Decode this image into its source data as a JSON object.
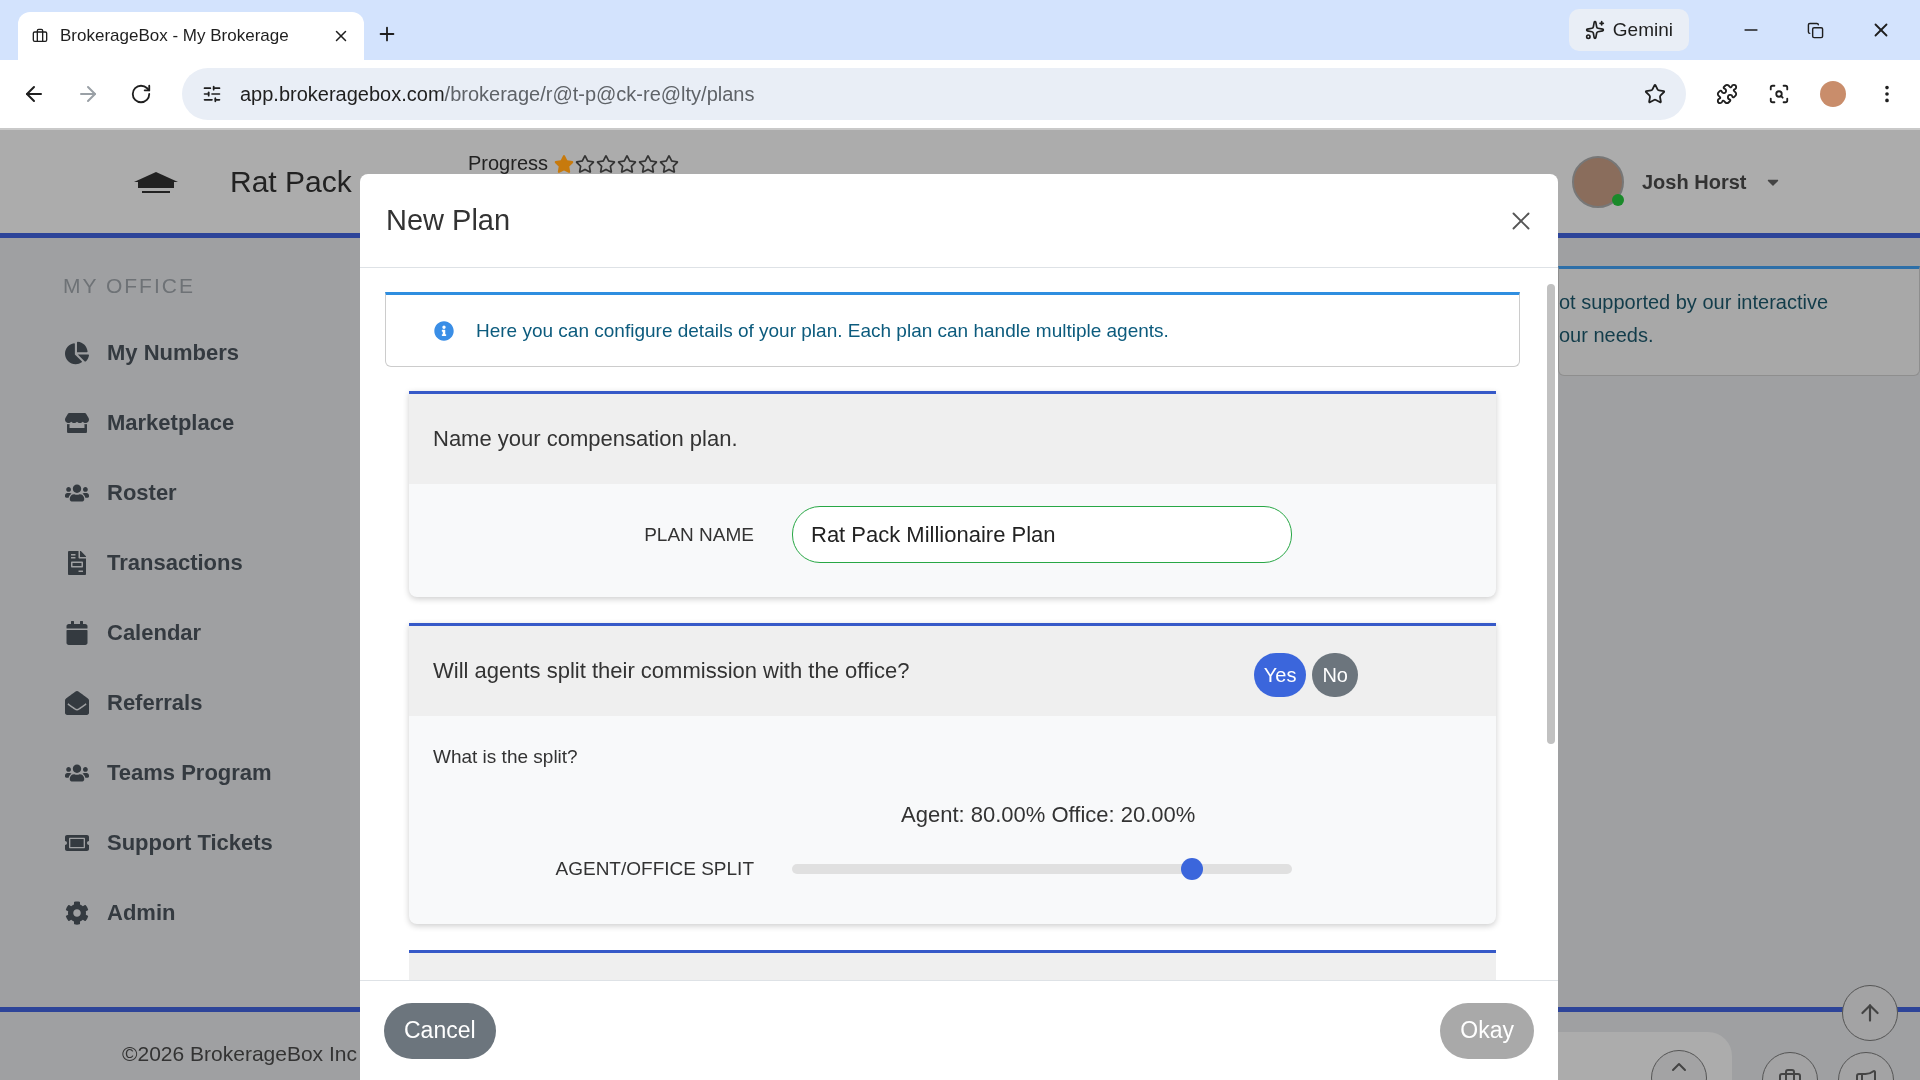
{
  "browser": {
    "tab_title": "BrokerageBox - My Brokerage",
    "gemini": "Gemini",
    "url_host": "app.brokeragebox.com",
    "url_path": "/brokerage/r@t-p@ck-re@lty/plans"
  },
  "header": {
    "brand": "Rat Pack",
    "progress_label": "Progress",
    "stars": 1,
    "user": "Josh Horst"
  },
  "sidebar": {
    "heading": "MY OFFICE",
    "items": [
      {
        "label": "My Numbers"
      },
      {
        "label": "Marketplace"
      },
      {
        "label": "Roster"
      },
      {
        "label": "Transactions"
      },
      {
        "label": "Calendar"
      },
      {
        "label": "Referrals"
      },
      {
        "label": "Teams Program"
      },
      {
        "label": "Support Tickets"
      },
      {
        "label": "Admin"
      }
    ]
  },
  "notice": {
    "lines": [
      "ot supported by our interactive",
      "our needs."
    ]
  },
  "footer": {
    "copyright": "©2026 BrokerageBox Inc"
  },
  "modal": {
    "title": "New Plan",
    "info": "Here you can configure details of your plan. Each plan can handle multiple agents.",
    "sections": [
      {
        "kind": "name",
        "question": "Name your compensation plan.",
        "field_label": "PLAN NAME",
        "value": "Rat Pack Millionaire Plan"
      },
      {
        "kind": "split",
        "question": "Will agents split their commission with the office?",
        "options": [
          {
            "label": "Yes",
            "selected": true
          },
          {
            "label": "No",
            "selected": false
          }
        ],
        "sub_question": "What is the split?",
        "reading": "Agent: 80.00% Office: 20.00%",
        "slider_label": "AGENT/OFFICE SPLIT",
        "level": 0.8
      }
    ],
    "buttons": [
      {
        "label": "Cancel",
        "disabled": false
      },
      {
        "label": "Okay",
        "disabled": true
      }
    ]
  }
}
